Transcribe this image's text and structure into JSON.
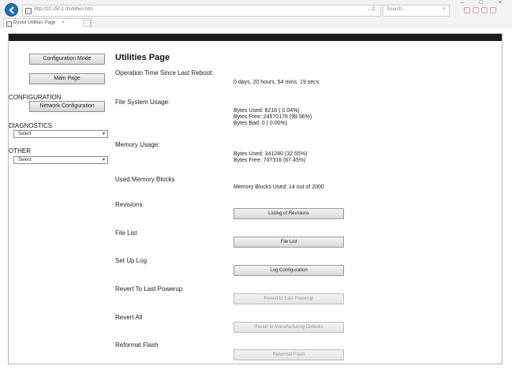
{
  "browser": {
    "url": "http://10.150.1.0/utilities.htm",
    "address_go": "→ C",
    "search_placeholder": "Search...",
    "search_glyph": "⌕",
    "tab_title": "Dyvex Utilities Page",
    "tab_close": "×",
    "window_controls": "– □ ×"
  },
  "sidebar": {
    "config_mode_button": "Configuration Mode",
    "main_page_button": "Main Page",
    "configuration_heading": "CONFIGURATION",
    "network_config_button": "Network Configuration",
    "diagnostics_heading": "DIAGNOSTICS",
    "diagnostics_select": "Select",
    "other_heading": "OTHER",
    "other_select": "Select"
  },
  "main": {
    "title": "Utilities Page",
    "operation_time_label": "Operation Time Since Last Reboot:",
    "operation_time_value": "0 days, 20 hours, 54 mins, 19 secs",
    "fs_label": "File System Usage:",
    "fs_used": "Bytes Used: 8216 ( 0.04%)",
    "fs_free": "Bytes Free: 24570176 (99.96%)",
    "fs_bad": "Bytes Bad: 0 ( 0.00%)",
    "mem_label": "Memory Usage:",
    "mem_used": "Bytes Used: 341280 (32.55%)",
    "mem_free": "Bytes Free: 707316 (67.45%)",
    "blocks_label": "Used Memory Blocks",
    "blocks_value": "Memory Blocks Used: 14 out of 2000",
    "revisions_label": "Revisions",
    "revisions_button": "Listing of Revisions",
    "filelist_label": "File List",
    "filelist_button": "File List",
    "setuplog_label": "Set Up Log",
    "setuplog_button": "Log Configuration",
    "revert_powerup_label": "Revert To Last Powerup",
    "revert_powerup_button": "Revert to Last Powerup",
    "revert_all_label": "Revert All",
    "revert_all_button": "Revert to Manufacturing Defaults",
    "reformat_label": "Reformat Flash",
    "reformat_button": "Reformat Flash"
  }
}
